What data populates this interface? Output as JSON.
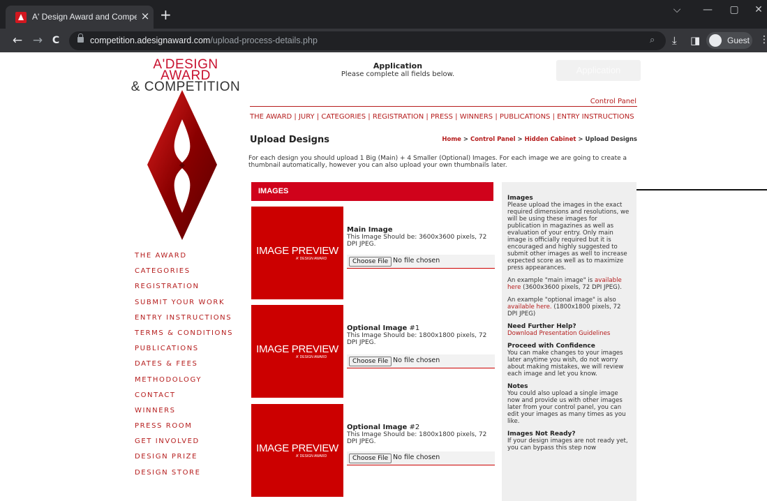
{
  "browser": {
    "tab_title": "A' Design Award and Competitio",
    "tab_close": "×",
    "new_tab": "+",
    "url_host": "competition.adesignaward.com",
    "url_path": "/upload-process-details.php",
    "profile_label": "Guest",
    "icons": {
      "back": "←",
      "forward": "→",
      "reload": "C",
      "zoom": "⌕",
      "download": "⤓",
      "sidepanel": "◨",
      "menu": "⋮",
      "minimize": "—",
      "maximize": "▢",
      "close": "✕",
      "tab_search": "⌵"
    }
  },
  "header": {
    "logo_line1": "A'DESIGN AWARD",
    "logo_line2": "& COMPETITION",
    "app_title": "Application",
    "app_subtitle": "Please complete all fields below.",
    "ghost_button": "Application"
  },
  "left_nav": [
    "THE AWARD",
    "CATEGORIES",
    "REGISTRATION",
    "SUBMIT YOUR WORK",
    "ENTRY INSTRUCTIONS",
    "TERMS & CONDITIONS",
    "PUBLICATIONS",
    "DATES & FEES",
    "METHODOLOGY",
    "CONTACT",
    "WINNERS",
    "PRESS ROOM",
    "GET INVOLVED",
    "DESIGN PRIZE",
    "DESIGN STORE"
  ],
  "control_panel_link": "Control Panel",
  "top_nav": [
    "THE AWARD",
    "JURY",
    "CATEGORIES",
    "REGISTRATION",
    "PRESS",
    "WINNERS",
    "PUBLICATIONS",
    "ENTRY INSTRUCTIONS"
  ],
  "top_nav_separator": " | ",
  "page_title": "Upload Designs",
  "breadcrumb": {
    "home": "Home",
    "control_panel": "Control Panel",
    "hidden_cabinet": "Hidden Cabinet",
    "current": "Upload Designs",
    "sep": " > "
  },
  "intro": "For each design you should upload 1 Big (Main) + 4 Smaller (Optional) Images. For each image we are going to create a thumbnail automatically, however you can also upload your own thumbnails later.",
  "images_section_label": "IMAGES",
  "image_rows": [
    {
      "preview_text": "IMAGE PREVIEW",
      "preview_sub": "A' DESIGN AWARD",
      "title": "Main Image",
      "title_suffix": "",
      "desc": "This Image Should be: 3600x3600 pixels, 72 DPI JPEG.",
      "button": "Choose File",
      "status": "No file chosen"
    },
    {
      "preview_text": "IMAGE PREVIEW",
      "preview_sub": "A' DESIGN AWARD",
      "title": "Optional Image",
      "title_suffix": " #1",
      "desc": "This Image Should be: 1800x1800 pixels, 72 DPI JPEG.",
      "button": "Choose File",
      "status": "No file chosen"
    },
    {
      "preview_text": "IMAGE PREVIEW",
      "preview_sub": "A' DESIGN AWARD",
      "title": "Optional Image",
      "title_suffix": " #2",
      "desc": "This Image Should be: 1800x1800 pixels, 72 DPI JPEG.",
      "button": "Choose File",
      "status": "No file chosen"
    }
  ],
  "sidebar": {
    "images_title": "Images",
    "images_text": "Please upload the images in the exact required dimensions and resolutions, we will be using these images for publication in magazines as well as evaluation of your entry. Only main image is officially required but it is encouraged and highly suggested to submit other images as well to increase expected score as well as to maximize press appearances.",
    "main_example_pre": "An example \"main image\" is ",
    "main_example_link": "available here",
    "main_example_post": " (3600x3600 pixels, 72 DPI JPEG).",
    "opt_example_pre": "An example \"optional image\" is also ",
    "opt_example_link": "available here.",
    "opt_example_post": " (1800x1800 pixels, 72 DPI JPEG)",
    "help_title": "Need Further Help?",
    "help_link": "Download Presentation Guidelines",
    "confidence_title": "Proceed with Confidence",
    "confidence_text": "You can make changes to your images later anytime you wish, do not worry about making mistakes, we will review each image and let you know.",
    "notes_title": "Notes",
    "notes_text": "You could also upload a single image now and provide us with other images later from your control panel, you can edit your images as many times as you like.",
    "notready_title": "Images Not Ready?",
    "notready_text": "If your design images are not ready yet, you can bypass this step now"
  },
  "colors": {
    "brand_red": "#cc0000",
    "link_red": "#b51c1c",
    "chrome_dark": "#202124"
  }
}
